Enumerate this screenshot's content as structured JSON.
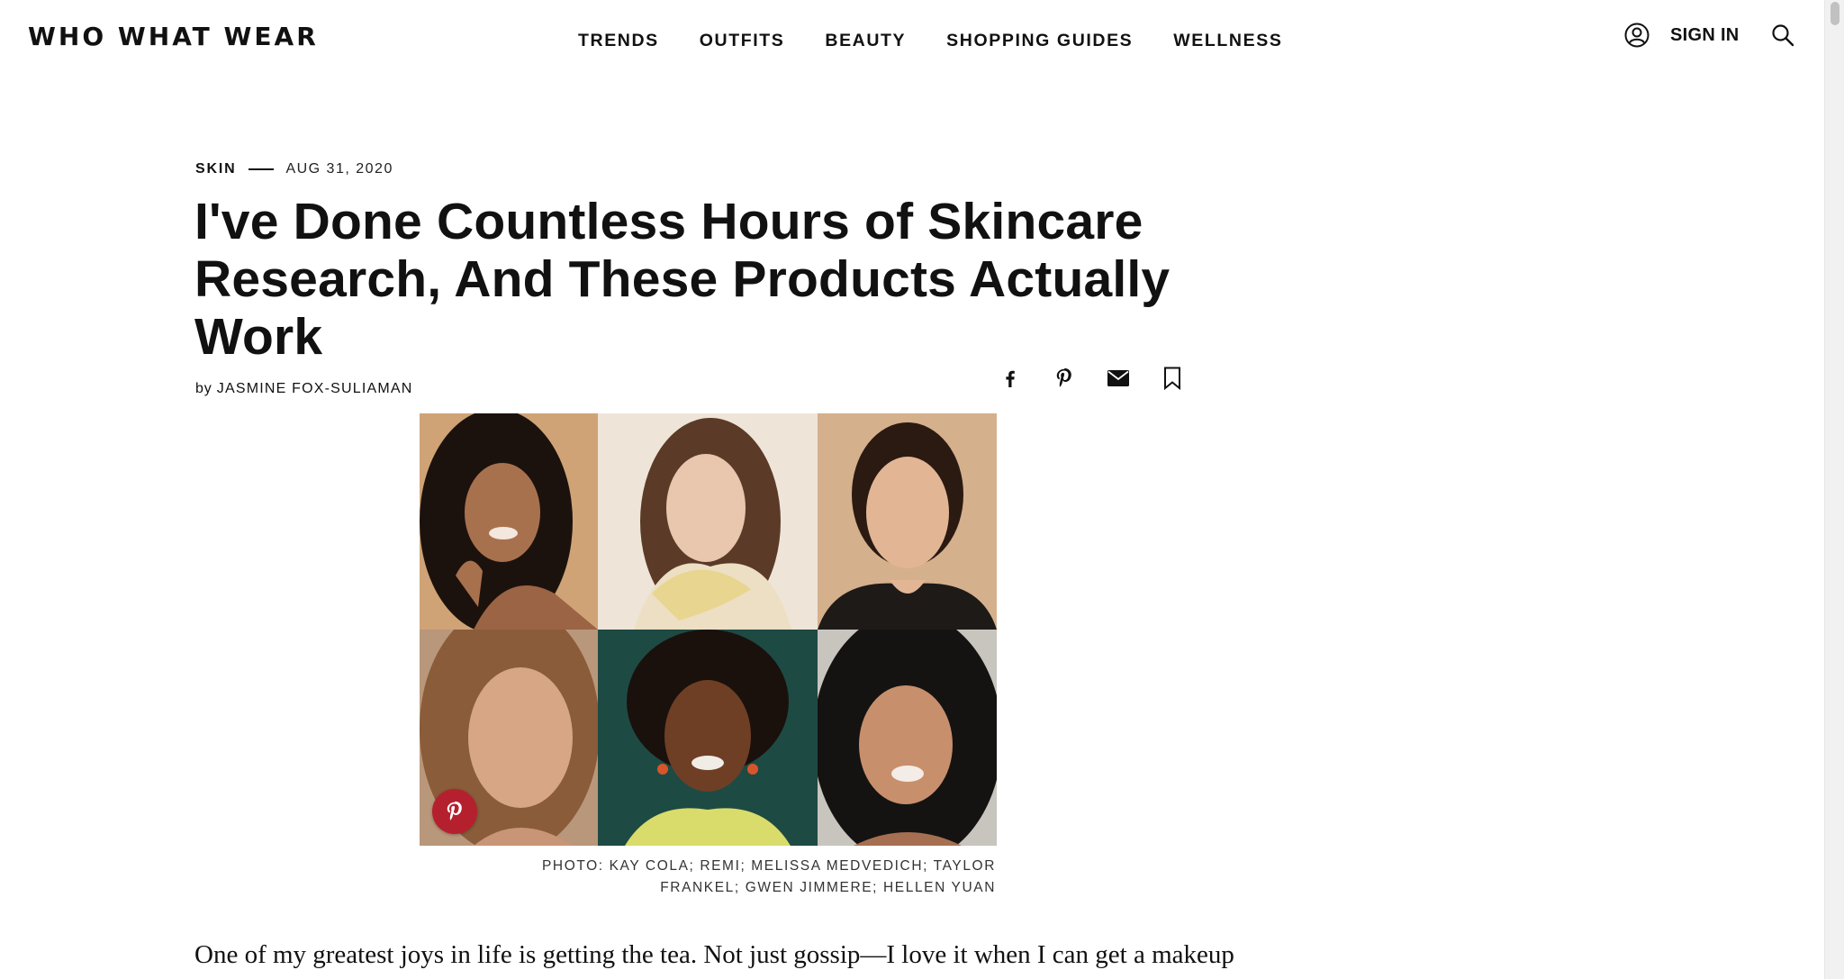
{
  "header": {
    "logo": "WHO WHAT WEAR",
    "nav": [
      "TRENDS",
      "OUTFITS",
      "BEAUTY",
      "SHOPPING GUIDES",
      "WELLNESS"
    ],
    "sign_in": "SIGN IN",
    "icons": {
      "account": "user-circle-icon",
      "search": "search-icon"
    }
  },
  "article": {
    "category": "SKIN",
    "date": "AUG 31, 2020",
    "title": "I've Done Countless Hours of Skincare Research, And These Products Actually Work",
    "byline_prefix": "by",
    "author": "JASMINE FOX-SULIAMAN",
    "share_icons": [
      "facebook-icon",
      "pinterest-icon",
      "email-icon",
      "bookmark-icon"
    ],
    "photo_caption": "PHOTO: KAY COLA; REMI; MELISSA MEDVEDICH; TAYLOR FRANKEL; GWEN JIMMERE; HELLEN YUAN",
    "body_first_line": "One of my greatest joys in life is getting the tea. Not just gossip—I love it when I can get a makeup"
  },
  "colors": {
    "text": "#111111",
    "pinterest_red": "#b5202e",
    "background": "#ffffff"
  }
}
